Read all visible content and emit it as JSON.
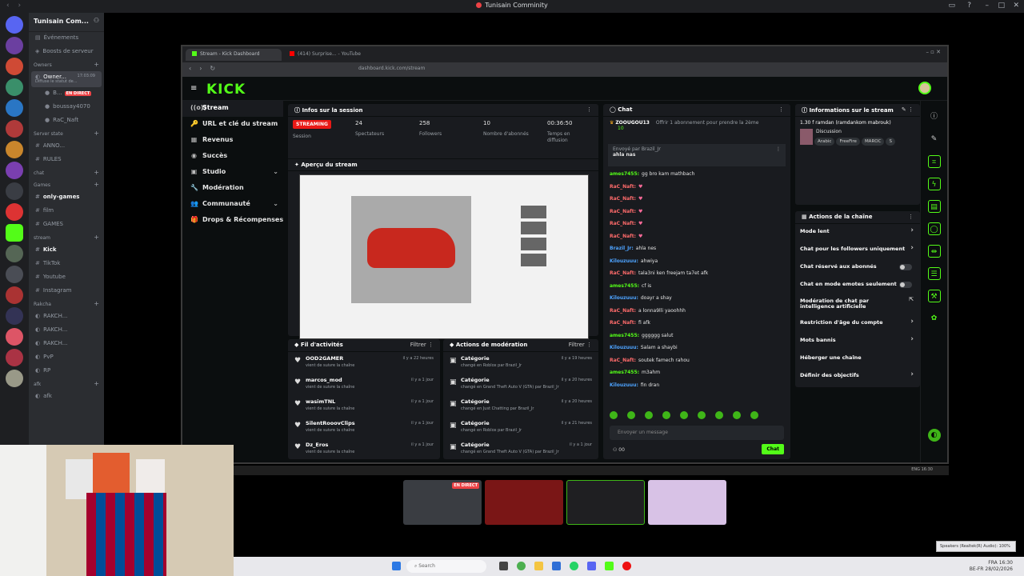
{
  "window": {
    "title": "Tunisain Comminity"
  },
  "server": {
    "name": "Tunisain Com...",
    "top_items": [
      "Événements",
      "Boosts de serveur"
    ],
    "categories": {
      "owners": "Owners",
      "server_stats": "Server state",
      "chat": "chat",
      "games": "Games",
      "stream": "stream",
      "rakcha": "Rakcha",
      "afk": "afk"
    },
    "owner_channel": "Owner...",
    "owner_time": "17:03:09",
    "owner_sub": "Diffuse le statut de...",
    "voice_users": [
      "B...",
      "boussay4070",
      "RaC_Naft"
    ],
    "live_label": "EN DIRECT",
    "text_channels_stats": [
      "ANNO...",
      "RULES"
    ],
    "text_channels_games": [
      "only-games",
      "film",
      "GAMES"
    ],
    "text_channels_stream": [
      "Kick",
      "TikTok",
      "Youtube",
      "Instagram"
    ],
    "voice_rakcha": [
      "RAKCH...",
      "RAKCH...",
      "RAKCH...",
      "PvP",
      "RP"
    ],
    "afk_channel": "afk"
  },
  "browser": {
    "tab1": "Stream - Kick Dashboard",
    "tab2": "(414) Surprise... - YouTube",
    "url": "dashboard.kick.com/stream"
  },
  "kick": {
    "logo": "KICK",
    "sidebar": [
      {
        "label": "Stream",
        "icon": "((o))"
      },
      {
        "label": "URL et clé du stream",
        "icon": "🔑"
      },
      {
        "label": "Revenus",
        "icon": "▦"
      },
      {
        "label": "Succès",
        "icon": "◉"
      },
      {
        "label": "Studio",
        "icon": "▣"
      },
      {
        "label": "Modération",
        "icon": "🔧"
      },
      {
        "label": "Communauté",
        "icon": "👥"
      },
      {
        "label": "Drops & Récompenses",
        "icon": "🎁"
      }
    ],
    "session": {
      "title": "Infos sur la session",
      "status": "STREAMING",
      "status_label": "Session",
      "viewers": "24",
      "viewers_label": "Spectateurs",
      "followers": "258",
      "followers_label": "Followers",
      "subs": "10",
      "subs_label": "Nombre d'abonnés",
      "uptime": "00:36:50",
      "uptime_label": "Temps en diffusion"
    },
    "preview_title": "Aperçu du stream",
    "activity": {
      "title": "Fil d'activités",
      "filter": "Filtrer",
      "items": [
        {
          "name": "OOD2GAMER",
          "sub": "vient de suivre la chaîne",
          "time": "il y a 22 heures"
        },
        {
          "name": "marcos_mod",
          "sub": "vient de suivre la chaîne",
          "time": "il y a 1 jour"
        },
        {
          "name": "wasimTNL",
          "sub": "vient de suivre la chaîne",
          "time": "il y a 1 jour"
        },
        {
          "name": "SilentRooovClips",
          "sub": "vient de suivre la chaîne",
          "time": "il y a 1 jour"
        },
        {
          "name": "Dz_Eros",
          "sub": "vient de suivre la chaîne",
          "time": "il y a 1 jour"
        }
      ]
    },
    "moderation": {
      "title": "Actions de modération",
      "filter": "Filtrer",
      "items": [
        {
          "name": "Catégorie",
          "sub": "changé en Roblox par Brazil_Jr",
          "time": "il y a 19 heures"
        },
        {
          "name": "Catégorie",
          "sub": "changé en Grand Theft Auto V (GTA) par Brazil_Jr",
          "time": "il y a 20 heures"
        },
        {
          "name": "Catégorie",
          "sub": "changé en Just Chatting par Brazil_Jr",
          "time": "il y a 20 heures"
        },
        {
          "name": "Catégorie",
          "sub": "changé en Roblox par Brazil_Jr",
          "time": "il y a 21 heures"
        },
        {
          "name": "Catégorie",
          "sub": "changé en Grand Theft Auto V (GTA) par Brazil_Jr",
          "time": "il y a 1 jour"
        }
      ]
    },
    "chat": {
      "title": "Chat",
      "top_user": "ZOOUGOU13",
      "top_user_sub": "10",
      "top_msg": "Offrir 1 abonnement pour prendre la 2ème",
      "pinned_by": "Envoyé par  Brazil_Jr",
      "pinned_msg": "ahla nas",
      "lines": [
        {
          "user": "ames7455:",
          "cls": "u-green",
          "msg": "gg bro kam mathbach"
        },
        {
          "user": "RaC_Naft:",
          "cls": "u-red",
          "msg": "♥"
        },
        {
          "user": "RaC_Naft:",
          "cls": "u-red",
          "msg": "♥"
        },
        {
          "user": "RaC_Naft:",
          "cls": "u-red",
          "msg": "♥"
        },
        {
          "user": "RaC_Naft:",
          "cls": "u-red",
          "msg": "♥"
        },
        {
          "user": "RaC_Naft:",
          "cls": "u-red",
          "msg": "♥"
        },
        {
          "user": "Brazil_Jr:",
          "cls": "u-blue",
          "msg": "ahla nes"
        },
        {
          "user": "Kilouzuuu:",
          "cls": "u-blue",
          "msg": "ahwiya"
        },
        {
          "user": "RaC_Naft:",
          "cls": "u-red",
          "msg": "tala3ni ken freejam ta7et afk"
        },
        {
          "user": "ames7455:",
          "cls": "u-green",
          "msg": "cf is"
        },
        {
          "user": "Kilouzuuu:",
          "cls": "u-blue",
          "msg": "doayr a shay"
        },
        {
          "user": "RaC_Naft:",
          "cls": "u-red",
          "msg": "a lonna9lli yaoohhh"
        },
        {
          "user": "RaC_Naft:",
          "cls": "u-red",
          "msg": "fi afk"
        },
        {
          "user": "ames7455:",
          "cls": "u-green",
          "msg": "gggggg salut"
        },
        {
          "user": "Kilouzuuu:",
          "cls": "u-blue",
          "msg": "Salam a shaybi"
        },
        {
          "user": "RaC_Naft:",
          "cls": "u-red",
          "msg": "soutek famech rahou"
        },
        {
          "user": "ames7455:",
          "cls": "u-green",
          "msg": "m3ahm"
        },
        {
          "user": "Kilouzuuu:",
          "cls": "u-blue",
          "msg": "fin dran"
        }
      ],
      "placeholder": "Envoyer un message",
      "count": "00",
      "send": "Chat"
    },
    "info": {
      "title": "Informations sur le stream",
      "stream_title": "1.30 f ramdan (ramdankom mabrouk)",
      "category": "Discussion",
      "tags": [
        "Arabic",
        "FreeFire",
        "MAROC",
        "S"
      ]
    },
    "actions": {
      "title": "Actions de la chaîne",
      "items": [
        {
          "label": "Mode lent",
          "type": "chev"
        },
        {
          "label": "Chat pour les followers uniquement",
          "type": "chev"
        },
        {
          "label": "Chat réservé aux abonnés",
          "type": "toggle"
        },
        {
          "label": "Chat en mode emotes seulement",
          "type": "toggle"
        },
        {
          "label": "Modération de chat par intelligence artificielle",
          "type": "ext"
        },
        {
          "label": "Restriction d'âge du compte",
          "type": "chev"
        },
        {
          "label": "Mots bannis",
          "type": "chev"
        },
        {
          "label": "Héberger une chaîne",
          "type": "none"
        },
        {
          "label": "Définir des objectifs",
          "type": "chev"
        }
      ]
    }
  },
  "tiles": {
    "live_label": "EN DIRECT"
  },
  "taskbar": {
    "search_placeholder": "Search",
    "lang": "FRA",
    "lang2": "BE-FR",
    "time": "16:30",
    "date": "28/02/2026",
    "tooltip": "Speakers (Realtek(R) Audio): 100%",
    "inner_lang": "ENG",
    "inner_time": "16:30"
  },
  "colors": {
    "kick_green": "#53fc18",
    "discord_bg": "#2b2d31",
    "live_red": "#ed4245"
  }
}
